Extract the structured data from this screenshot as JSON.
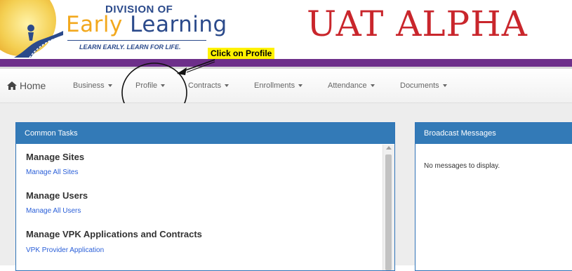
{
  "header": {
    "logo_division": "DIVISION OF",
    "logo_name_part1": "Early ",
    "logo_name_part2": "Learning",
    "logo_tagline": "LEARN EARLY. LEARN FOR LIFE.",
    "environment_title": "UAT ALPHA"
  },
  "annotation": {
    "hint_text": "Click on Profile"
  },
  "nav": {
    "home_label": "Home",
    "items": [
      {
        "label": "Business"
      },
      {
        "label": "Profile"
      },
      {
        "label": "Contracts"
      },
      {
        "label": "Enrollments"
      },
      {
        "label": "Attendance"
      },
      {
        "label": "Documents"
      }
    ]
  },
  "common_tasks": {
    "title": "Common Tasks",
    "sections": [
      {
        "heading": "Manage Sites",
        "link": "Manage All Sites"
      },
      {
        "heading": "Manage Users",
        "link": "Manage All Users"
      },
      {
        "heading": "Manage VPK Applications and Contracts",
        "link": "VPK Provider Application"
      }
    ]
  },
  "broadcast": {
    "title": "Broadcast Messages",
    "empty_text": "No messages to display."
  },
  "colors": {
    "brand_purple": "#6d2f8a",
    "panel_blue": "#337ab7",
    "uat_red": "#c9262c",
    "link_blue": "#2a5fd8",
    "highlight_yellow": "#fff200"
  }
}
